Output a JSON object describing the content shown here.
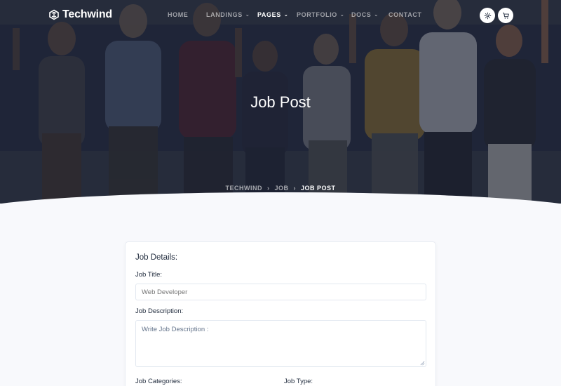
{
  "brand": {
    "name": "Techwind"
  },
  "nav": {
    "items": [
      {
        "label": "HOME",
        "has_dropdown": false,
        "active": false
      },
      {
        "label": "LANDINGS",
        "has_dropdown": true,
        "active": false
      },
      {
        "label": "PAGES",
        "has_dropdown": true,
        "active": true
      },
      {
        "label": "PORTFOLIO",
        "has_dropdown": true,
        "active": false
      },
      {
        "label": "DOCS",
        "has_dropdown": true,
        "active": false
      },
      {
        "label": "CONTACT",
        "has_dropdown": false,
        "active": false
      }
    ],
    "icons": [
      "gear-icon",
      "cart-icon"
    ]
  },
  "hero": {
    "title": "Job Post",
    "breadcrumb": [
      "TECHWIND",
      "JOB",
      "JOB POST"
    ]
  },
  "form": {
    "heading": "Job Details:",
    "job_title": {
      "label": "Job Title:",
      "placeholder": "Web Developer"
    },
    "job_description": {
      "label": "Job Description:",
      "placeholder": "Write Job Description :"
    },
    "job_categories": {
      "label": "Job Categories:"
    },
    "job_type": {
      "label": "Job Type:"
    }
  }
}
